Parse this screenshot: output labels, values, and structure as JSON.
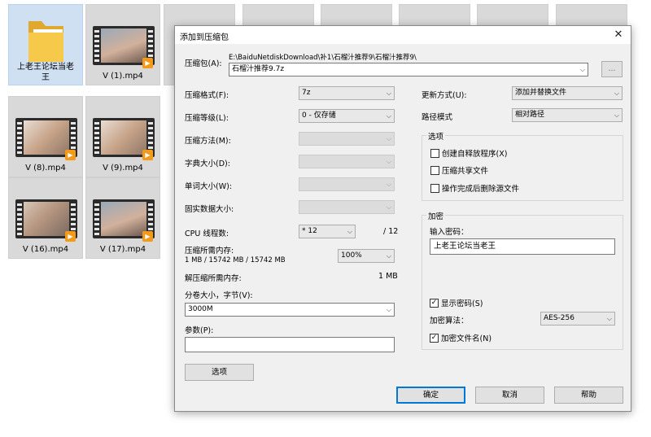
{
  "explorer": {
    "files": [
      {
        "name": "上老王论坛当老王",
        "type": "folder"
      },
      {
        "name": "V (1).mp4",
        "type": "video"
      },
      {
        "name": "V (8).mp4",
        "type": "video"
      },
      {
        "name": "V (9).mp4",
        "type": "video"
      },
      {
        "name": "V (16).mp4",
        "type": "video"
      },
      {
        "name": "V (17).mp4",
        "type": "video"
      }
    ]
  },
  "dialog": {
    "title": "添加到压缩包",
    "close_glyph": "✕",
    "archive": {
      "label": "压缩包(A):",
      "path": "E:\\BaiduNetdiskDownload\\补1\\石榴汁推荐9\\石榴汁推荐9\\",
      "value": "石榴汁推荐9.7z",
      "browse_label": "..."
    },
    "format": {
      "label": "压缩格式(F):",
      "value": "7z"
    },
    "level": {
      "label": "压缩等级(L):",
      "value": "0 - 仅存储"
    },
    "method": {
      "label": "压缩方法(M):",
      "value": ""
    },
    "dict": {
      "label": "字典大小(D):",
      "value": ""
    },
    "word": {
      "label": "单词大小(W):",
      "value": ""
    },
    "solid": {
      "label": "固实数据大小:",
      "value": ""
    },
    "cpu": {
      "label": "CPU 线程数:",
      "value": "* 12",
      "max": "/ 12"
    },
    "mem_compress": {
      "label": "压缩所需内存:",
      "detail": "1 MB / 15742 MB / 15742 MB",
      "percent": "100%"
    },
    "mem_decompress": {
      "label": "解压缩所需内存:",
      "value": "1 MB"
    },
    "volume": {
      "label": "分卷大小，字节(V):",
      "value": "3000M"
    },
    "params": {
      "label": "参数(P):",
      "value": ""
    },
    "options_button": "选项",
    "update": {
      "label": "更新方式(U):",
      "value": "添加并替换文件"
    },
    "pathmode": {
      "label": "路径模式",
      "value": "相对路径"
    },
    "options_group": {
      "title": "选项",
      "sfx": "创建自释放程序(X)",
      "shared": "压缩共享文件",
      "delete": "操作完成后删除源文件"
    },
    "encryption": {
      "title": "加密",
      "pw_label": "输入密码：",
      "password": "上老王论坛当老王",
      "show_pw": "显示密码(S)",
      "method_label": "加密算法：",
      "method": "AES-256",
      "encrypt_names": "加密文件名(N)"
    },
    "ok": "确定",
    "cancel": "取消",
    "help": "帮助"
  }
}
